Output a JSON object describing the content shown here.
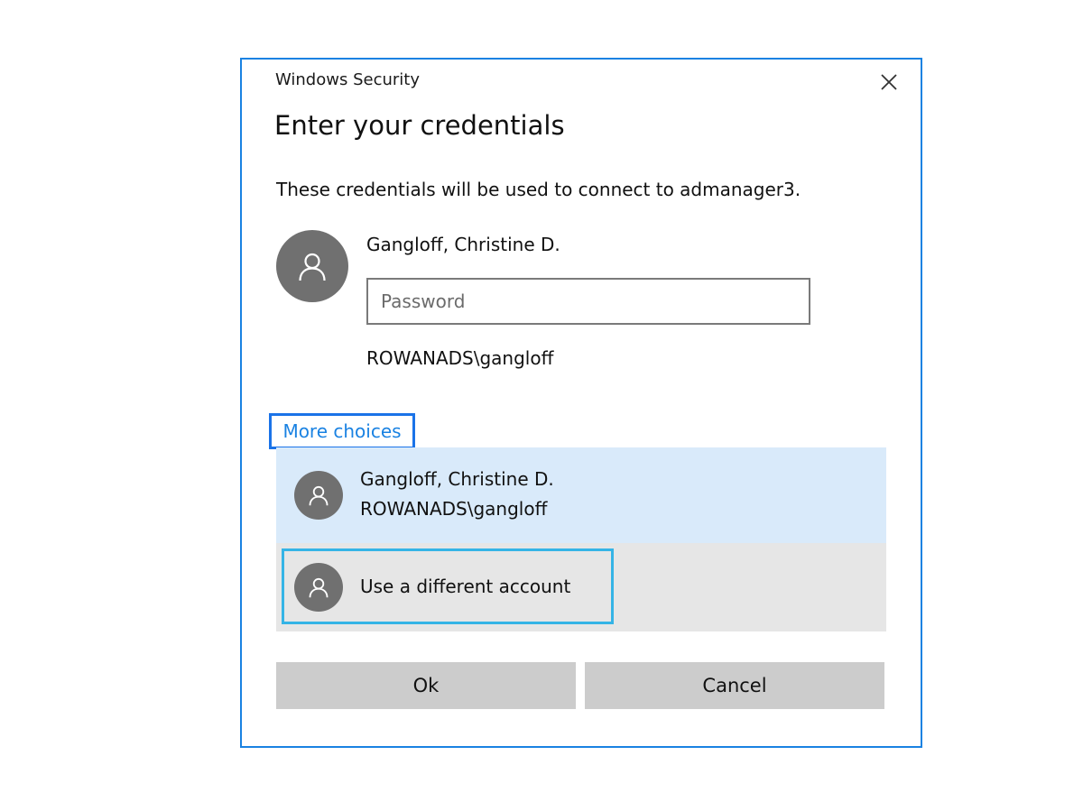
{
  "dialog": {
    "window_title": "Windows Security",
    "heading": "Enter your credentials",
    "description": "These credentials will be used to connect to admanager3.",
    "current_user": {
      "display_name": "Gangloff, Christine D.",
      "domain_user": "ROWANADS\\gangloff"
    },
    "password": {
      "placeholder": "Password",
      "value": ""
    },
    "more_choices_label": "More choices",
    "accounts": [
      {
        "display_name": "Gangloff, Christine D.",
        "domain_user": "ROWANADS\\gangloff",
        "selected": true
      },
      {
        "display_name": "Use a different account",
        "selected": false,
        "focused": true
      }
    ],
    "buttons": {
      "ok": "Ok",
      "cancel": "Cancel"
    }
  },
  "icons": {
    "close": "close-icon",
    "avatar": "user-avatar-icon"
  },
  "colors": {
    "accent_border": "#1a82e2",
    "link": "#1a82e2",
    "focus_ring": "#35b4e6",
    "selected_row": "#d9eafa",
    "row_background": "#e6e6e6",
    "button_background": "#cccccc",
    "avatar_background": "#707070"
  }
}
